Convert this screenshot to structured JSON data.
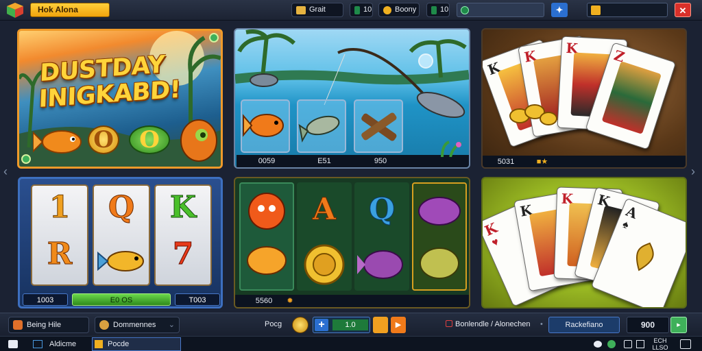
{
  "header": {
    "title": "Hok Alona",
    "chips": [
      {
        "label": "Grait",
        "icon": "book-icon"
      },
      {
        "label": "Boony",
        "icon": "coin-icon"
      }
    ],
    "counter_badges": [
      "10",
      "10"
    ],
    "buttons": {
      "action_icon": "star-icon",
      "close_label": "✕"
    }
  },
  "tiles": {
    "fish_hero": {
      "title_line1": "DUSTDAY",
      "title_line2": "INIGKABD!",
      "coin_labels": [
        "O",
        "O"
      ]
    },
    "fishing": {
      "stats": [
        "0059",
        "E51",
        "950"
      ]
    },
    "cards_brown": {
      "value": "5031"
    },
    "slot_machine": {
      "reel_top": [
        "1",
        "Q",
        "K"
      ],
      "reel_bottom": [
        "R",
        "",
        "7"
      ],
      "left_value": "1003",
      "center_value": "E0 OS",
      "right_value": "T003"
    },
    "fish_slots": {
      "letters": [
        "A",
        "Q"
      ],
      "value": "5560"
    },
    "cards_green": {
      "ranks": [
        "K",
        "K",
        "K",
        "K",
        "A"
      ]
    }
  },
  "bottom": {
    "left_items": [
      {
        "label": "Being Hile",
        "icon": "fire-icon"
      },
      {
        "label": "Dommennes",
        "icon": "gift-icon"
      }
    ],
    "center_label": "Pocg",
    "amount_value": "1.0",
    "message": "Bonlendle / Alonechen",
    "provider": "Rackefiano",
    "balance": "900"
  },
  "taskbar": {
    "items": [
      "Aldicme",
      "Pocde"
    ],
    "time_top": "ECH",
    "time_bottom": "LLSO"
  },
  "colors": {
    "accent_gold": "#f1a40d",
    "close_red": "#d9302a",
    "play_green": "#3fb05a"
  }
}
